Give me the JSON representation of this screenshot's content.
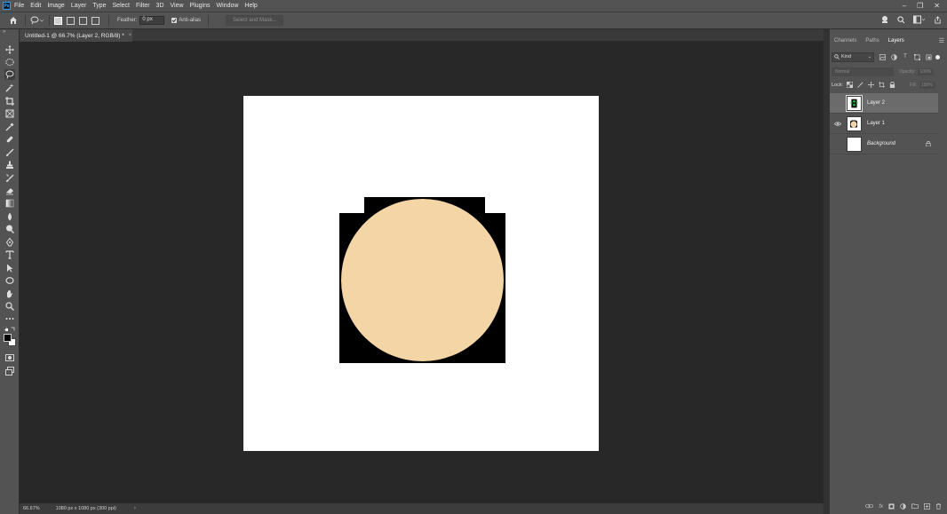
{
  "app": {
    "logo_text": "Ps"
  },
  "menu": {
    "items": [
      "File",
      "Edit",
      "Image",
      "Layer",
      "Type",
      "Select",
      "Filter",
      "3D",
      "View",
      "Plugins",
      "Window",
      "Help"
    ]
  },
  "window_controls": {
    "minimize": "–",
    "restore": "❐",
    "close": "✕"
  },
  "options_bar": {
    "feather_label": "Feather:",
    "feather_value": "0 px",
    "antialias_label": "Anti-alias",
    "antialias_checked": true,
    "select_and_mask_label": "Select and Mask..."
  },
  "document": {
    "tab_title": "Untitled-1 @ 66.7% (Layer 2, RGB/8) *",
    "close_glyph": "×",
    "background_color": "#ffffff",
    "face_color": "#f3d5a6",
    "shape_color": "#000000"
  },
  "status": {
    "zoom": "66.67%",
    "doc_info": "1080 px x 1080 px (300 ppi)",
    "arrow": "›"
  },
  "panel": {
    "tabs": [
      {
        "label": "Channels",
        "active": false
      },
      {
        "label": "Paths",
        "active": false
      },
      {
        "label": "Layers",
        "active": true
      }
    ],
    "filter_kind": "Kind",
    "blend_mode": "Normal",
    "opacity_label": "Opacity:",
    "opacity_value": "100%",
    "lock_label": "Lock:",
    "fill_label": "Fill:",
    "fill_value": "100%",
    "layers": [
      {
        "name": "Layer 2",
        "visible": false,
        "selected": true,
        "thumb": "layer2-green"
      },
      {
        "name": "Layer 1",
        "visible": true,
        "selected": false,
        "thumb": "layer1-face"
      },
      {
        "name": "Background",
        "visible": false,
        "selected": false,
        "locked": true,
        "thumb": "white"
      }
    ]
  },
  "colors": {
    "accent": "#31a8ff",
    "ui_panel": "#535353",
    "canvas_bg": "#282828"
  }
}
